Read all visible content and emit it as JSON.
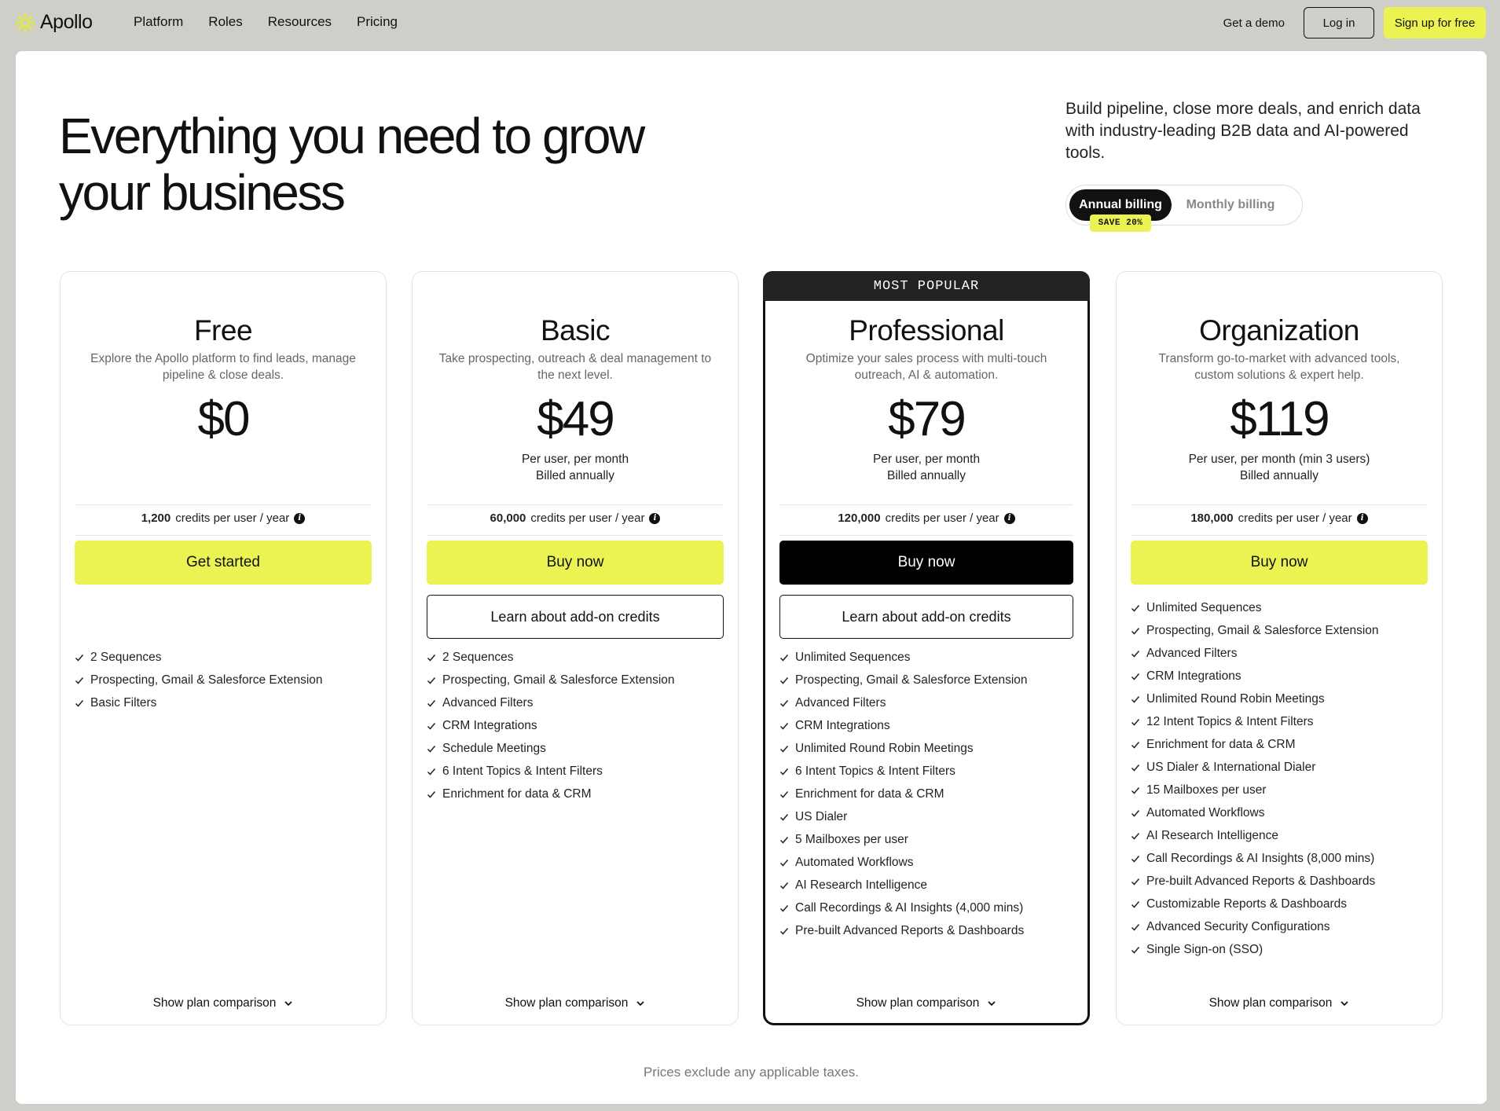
{
  "nav": {
    "logo": "Apollo",
    "links": [
      "Platform",
      "Roles",
      "Resources",
      "Pricing"
    ],
    "demo": "Get a demo",
    "login": "Log in",
    "signup": "Sign up for free"
  },
  "hero": {
    "title_line1": "Everything you need to grow",
    "title_line2": "your business",
    "subtitle": "Build pipeline, close more deals, and enrich data with industry-leading B2B data and AI-powered tools."
  },
  "billing": {
    "annual": "Annual billing",
    "monthly": "Monthly billing",
    "save": "SAVE 20%"
  },
  "plans": [
    {
      "name": "Free",
      "desc": "Explore the Apollo platform to find leads, manage pipeline & close deals.",
      "price": "$0",
      "unit1": "",
      "unit2": "",
      "credits_num": "1,200",
      "credits_text": "credits per user / year",
      "cta": "Get started",
      "addon": "",
      "features": [
        "2 Sequences",
        "Prospecting, Gmail & Salesforce Extension",
        "Basic Filters"
      ],
      "compare": "Show plan comparison"
    },
    {
      "name": "Basic",
      "desc": "Take prospecting, outreach & deal management to the next level.",
      "price": "$49",
      "unit1": "Per user, per month",
      "unit2": "Billed annually",
      "credits_num": "60,000",
      "credits_text": "credits per user / year",
      "cta": "Buy now",
      "addon": "Learn about add-on credits",
      "features": [
        "2 Sequences",
        "Prospecting, Gmail & Salesforce Extension",
        "Advanced Filters",
        "CRM Integrations",
        "Schedule Meetings",
        "6 Intent Topics & Intent Filters",
        "Enrichment for data & CRM"
      ],
      "compare": "Show plan comparison"
    },
    {
      "name": "Professional",
      "banner": "MOST POPULAR",
      "desc": "Optimize your sales process with multi-touch outreach, AI & automation.",
      "price": "$79",
      "unit1": "Per user, per month",
      "unit2": "Billed annually",
      "credits_num": "120,000",
      "credits_text": "credits per user / year",
      "cta": "Buy now",
      "addon": "Learn about add-on credits",
      "features": [
        "Unlimited Sequences",
        "Prospecting, Gmail & Salesforce Extension",
        "Advanced Filters",
        "CRM Integrations",
        "Unlimited Round Robin Meetings",
        "6 Intent Topics & Intent Filters",
        "Enrichment for data & CRM",
        "US Dialer",
        "5 Mailboxes per user",
        "Automated Workflows",
        "AI Research Intelligence",
        "Call Recordings & AI Insights (4,000 mins)",
        "Pre-built Advanced Reports & Dashboards"
      ],
      "compare": "Show plan comparison"
    },
    {
      "name": "Organization",
      "desc": "Transform go-to-market with advanced tools, custom solutions & expert help.",
      "price": "$119",
      "unit1": "Per user, per month (min 3 users)",
      "unit2": "Billed annually",
      "credits_num": "180,000",
      "credits_text": "credits per user / year",
      "cta": "Buy now",
      "addon": "",
      "features": [
        "Unlimited Sequences",
        "Prospecting, Gmail & Salesforce Extension",
        "Advanced Filters",
        "CRM Integrations",
        "Unlimited Round Robin Meetings",
        "12 Intent Topics & Intent Filters",
        "Enrichment for data & CRM",
        "US Dialer & International Dialer",
        "15 Mailboxes per user",
        "Automated Workflows",
        "AI Research Intelligence",
        "Call Recordings & AI Insights (8,000 mins)",
        "Pre-built Advanced Reports & Dashboards",
        "Customizable Reports & Dashboards",
        "Advanced Security Configurations",
        "Single Sign-on (SSO)"
      ],
      "compare": "Show plan comparison"
    }
  ],
  "footnote": "Prices exclude any applicable taxes.",
  "colors": {
    "accent": "#ebf353",
    "background": "#cfcfca",
    "dark": "#111111"
  }
}
